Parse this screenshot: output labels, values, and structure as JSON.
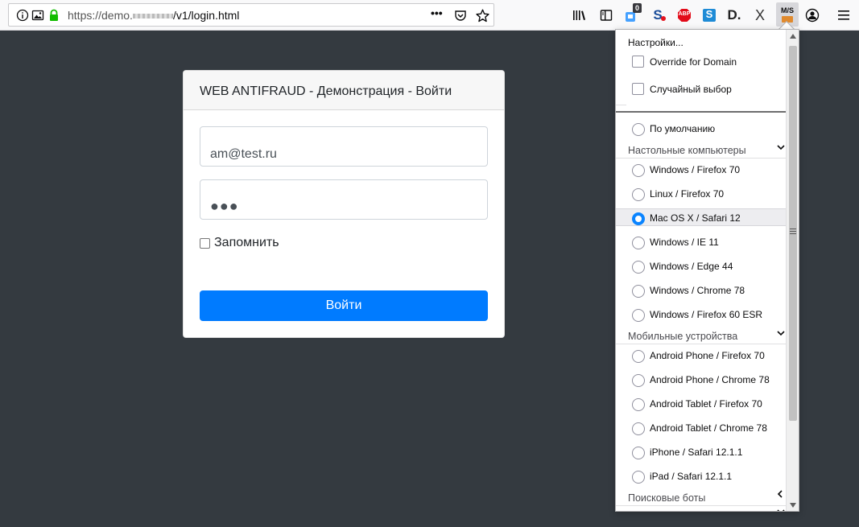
{
  "browser": {
    "url_prefix": "https://demo.",
    "url_suffix": "/v1/login.html",
    "page_actions_label": "•••",
    "toolbar_badge": "0",
    "extension_label": "M/S",
    "abp_label": "ABP",
    "s_label": "S",
    "d_label": "D.",
    "x_label": "X"
  },
  "login": {
    "title": "WEB ANTIFRAUD - Демонстрация - Войти",
    "email_value": "am@test.ru",
    "password_value": "●●●",
    "remember_label": "Запомнить",
    "submit_label": "Войти"
  },
  "panel": {
    "settings_label": "Настройки...",
    "override_label": "Override for Domain",
    "random_label": "Случайный выбор",
    "default_label": "По умолчанию",
    "groups": {
      "desktop": "Настольные компьютеры",
      "mobile": "Мобильные устройства",
      "bots": "Поисковые боты"
    },
    "desktop_items": [
      "Windows / Firefox 70",
      "Linux / Firefox 70",
      "Mac OS X / Safari 12",
      "Windows / IE 11",
      "Windows / Edge 44",
      "Windows / Chrome 78",
      "Windows / Firefox 60 ESR"
    ],
    "mobile_items": [
      "Android Phone / Firefox 70",
      "Android Phone / Chrome 78",
      "Android Tablet / Firefox 70",
      "Android Tablet / Chrome 78",
      "iPhone / Safari 12.1.1",
      "iPad / Safari 12.1.1"
    ],
    "selected_item": "Mac OS X / Safari 12"
  },
  "colors": {
    "page_bg": "#343a40",
    "primary": "#007bff",
    "radio_accent": "#0a84ff",
    "lock_green": "#12bc00"
  },
  "icons": [
    "info-icon",
    "image-icon",
    "lock-icon",
    "page-actions-icon",
    "pocket-icon",
    "bookmark-star-icon",
    "library-icon",
    "sidebar-icon",
    "notification-icon",
    "s-extension-icon",
    "adblock-icon",
    "skype-icon",
    "d-extension-icon",
    "x-extension-icon",
    "useragent-switcher-icon",
    "account-icon",
    "menu-icon",
    "chevron-down-icon"
  ]
}
